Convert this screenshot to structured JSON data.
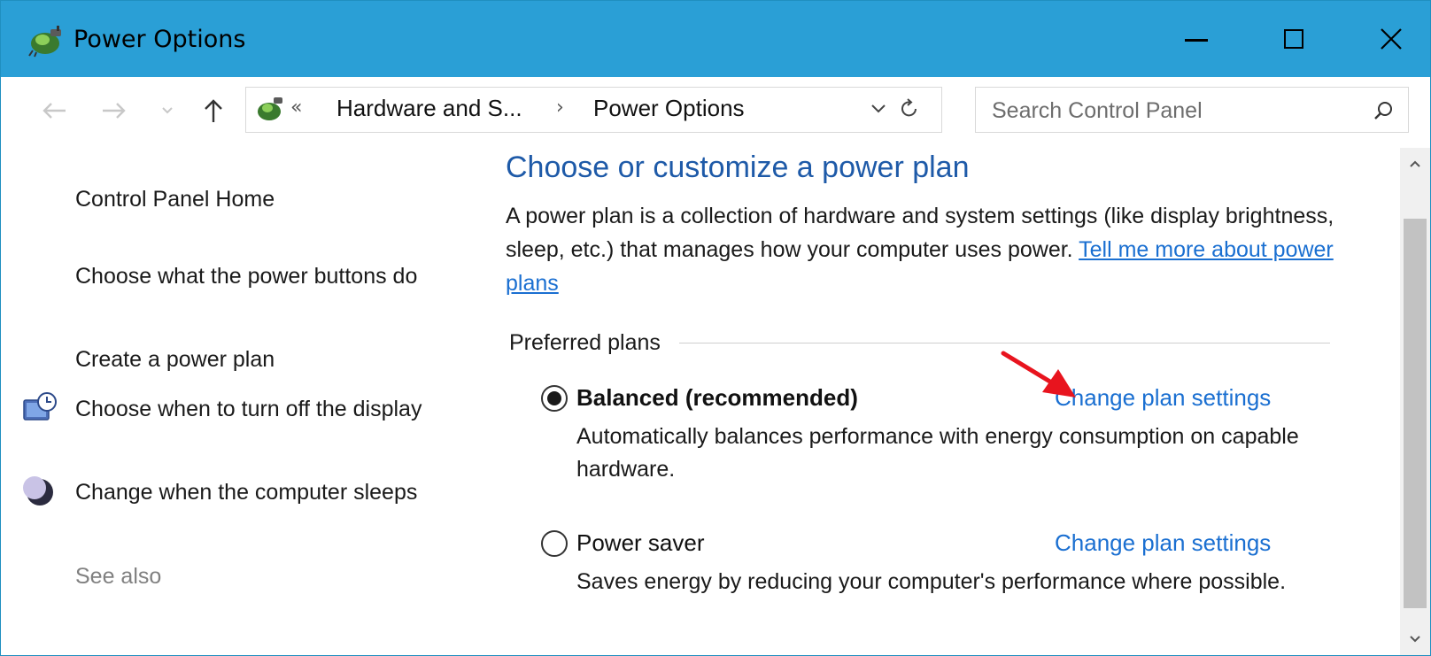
{
  "window": {
    "title": "Power Options",
    "app_icon": "power-options-icon",
    "controls": {
      "minimize": "minimize-icon",
      "maximize": "maximize-icon",
      "close": "close-icon"
    }
  },
  "navigation": {
    "back_icon": "back-arrow-icon",
    "forward_icon": "forward-arrow-icon",
    "recent_icon": "chevron-down-icon",
    "up_icon": "up-arrow-icon"
  },
  "address": {
    "overflow": "«",
    "crumbs": [
      "Hardware and S...",
      "Power Options"
    ],
    "separator": "›"
  },
  "search": {
    "placeholder": "Search Control Panel"
  },
  "sidebar": {
    "home": "Control Panel Home",
    "items": [
      {
        "label": "Choose what the power buttons do",
        "icon": ""
      },
      {
        "label": "Create a power plan",
        "icon": ""
      },
      {
        "label": "Choose when to turn off the display",
        "icon": "monitor-clock-icon"
      },
      {
        "label": "Change when the computer sleeps",
        "icon": "moon-icon"
      }
    ],
    "see_also": "See also"
  },
  "main": {
    "title": "Choose or customize a power plan",
    "description": "A power plan is a collection of hardware and system settings (like display brightness, sleep, etc.) that manages how your computer uses power.",
    "description_link": "Tell me more about power plans",
    "group_label": "Preferred plans",
    "plans": [
      {
        "name": "Balanced (recommended)",
        "selected": true,
        "link": "Change plan settings",
        "description": "Automatically balances performance with energy consumption on capable hardware."
      },
      {
        "name": "Power saver",
        "selected": false,
        "link": "Change plan settings",
        "description": "Saves energy by reducing your computer's performance where possible."
      }
    ]
  },
  "colors": {
    "titlebar": "#2a9fd6",
    "heading": "#1e5aa8",
    "link": "#1a6fd1",
    "annotation": "#e8141e"
  }
}
